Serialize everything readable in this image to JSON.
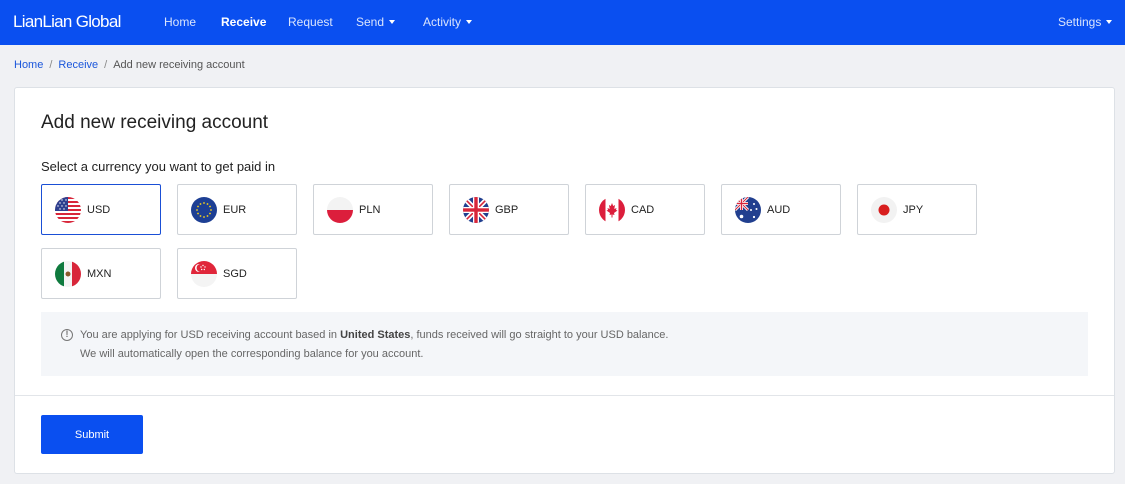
{
  "header": {
    "logo": "LianLian Global",
    "nav": [
      {
        "label": "Home"
      },
      {
        "label": "Receive"
      },
      {
        "label": "Request"
      },
      {
        "label": "Send"
      },
      {
        "label": "Activity"
      }
    ],
    "settings": "Settings"
  },
  "breadcrumb": [
    "Home",
    "Receive",
    "Add new receiving account"
  ],
  "breadcrumb_separator": "/",
  "page": {
    "title": "Add new receiving account",
    "subtitle": "Select a currency you want to get paid in",
    "selected_currency": "USD"
  },
  "currencies": [
    {
      "code": "USD",
      "icon": "us-flag-icon"
    },
    {
      "code": "EUR",
      "icon": "eu-flag-icon"
    },
    {
      "code": "PLN",
      "icon": "pl-flag-icon"
    },
    {
      "code": "GBP",
      "icon": "gb-flag-icon"
    },
    {
      "code": "CAD",
      "icon": "ca-flag-icon"
    },
    {
      "code": "AUD",
      "icon": "au-flag-icon"
    },
    {
      "code": "JPY",
      "icon": "jp-flag-icon"
    },
    {
      "code": "MXN",
      "icon": "mx-flag-icon"
    },
    {
      "code": "SGD",
      "icon": "sg-flag-icon"
    }
  ],
  "info": {
    "line1_pre": "You are applying for USD receiving account based in ",
    "line1_bold": "United States",
    "line1_post": ", funds received will go straight to your USD balance.",
    "line2": "We will automatically open the corresponding balance for you account."
  },
  "submit_label": "Submit",
  "colors": {
    "brand": "#0a4ff0",
    "selected_border": "#1a4fd6"
  }
}
